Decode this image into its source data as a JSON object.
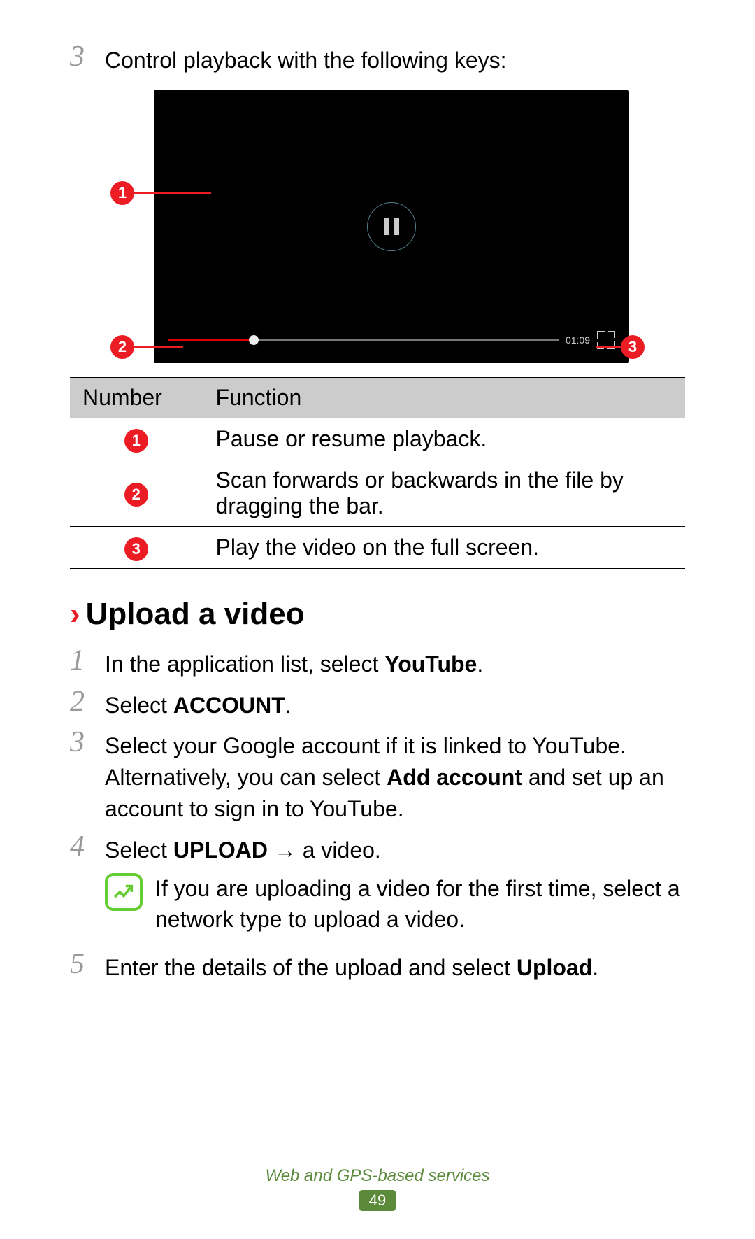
{
  "top_step": {
    "num": "3",
    "text": "Control playback with the following keys:"
  },
  "video": {
    "time": "01:09",
    "callouts": {
      "c1": "1",
      "c2": "2",
      "c3": "3"
    }
  },
  "table": {
    "head_number": "Number",
    "head_function": "Function",
    "rows": [
      {
        "n": "1",
        "f": "Pause or resume playback."
      },
      {
        "n": "2",
        "f": "Scan forwards or backwards in the file by dragging the bar."
      },
      {
        "n": "3",
        "f": "Play the video on the full screen."
      }
    ]
  },
  "section": {
    "chev": "›",
    "title": "Upload a video"
  },
  "steps": {
    "s1": {
      "num": "1",
      "pre": "In the application list, select ",
      "bold": "YouTube",
      "post": "."
    },
    "s2": {
      "num": "2",
      "pre": "Select ",
      "bold": "ACCOUNT",
      "post": "."
    },
    "s3": {
      "num": "3",
      "line1": "Select your Google account if it is linked to YouTube.",
      "line2_pre": "Alternatively, you can select ",
      "line2_bold": "Add account",
      "line2_post": " and set up an account to sign in to YouTube."
    },
    "s4": {
      "num": "4",
      "pre": "Select ",
      "bold": "UPLOAD",
      "arrow": " → ",
      "post": "a video."
    },
    "note": "If you are uploading a video for the first time, select a network type to upload a video.",
    "s5": {
      "num": "5",
      "pre": "Enter the details of the upload and select ",
      "bold": "Upload",
      "post": "."
    }
  },
  "footer": {
    "section": "Web and GPS-based services",
    "page": "49"
  }
}
